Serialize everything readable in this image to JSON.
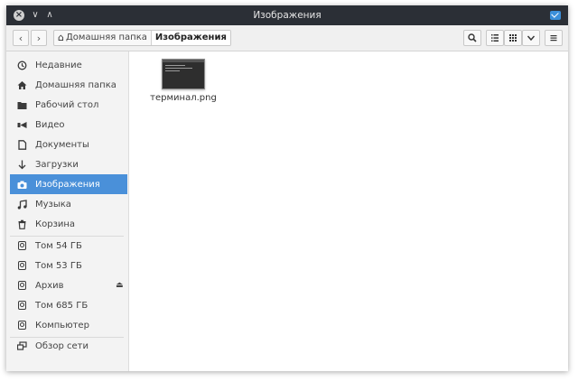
{
  "window": {
    "title": "Изображения"
  },
  "toolbar": {
    "breadcrumbs": [
      {
        "label": "Домашняя папка"
      },
      {
        "label": "Изображения"
      }
    ]
  },
  "sidebar": {
    "places": [
      {
        "label": "Недавние",
        "icon": "clock-icon"
      },
      {
        "label": "Домашняя папка",
        "icon": "home-icon"
      },
      {
        "label": "Рабочий стол",
        "icon": "folder-icon"
      },
      {
        "label": "Видео",
        "icon": "video-icon"
      },
      {
        "label": "Документы",
        "icon": "document-icon"
      },
      {
        "label": "Загрузки",
        "icon": "download-icon"
      },
      {
        "label": "Изображения",
        "icon": "camera-icon",
        "active": true
      },
      {
        "label": "Музыка",
        "icon": "music-icon"
      },
      {
        "label": "Корзина",
        "icon": "trash-icon"
      }
    ],
    "devices": [
      {
        "label": "Том 54 ГБ",
        "icon": "disk-icon"
      },
      {
        "label": "Том 53 ГБ",
        "icon": "disk-icon"
      },
      {
        "label": "Архив",
        "icon": "disk-icon",
        "ejectable": true
      },
      {
        "label": "Том 685 ГБ",
        "icon": "disk-icon"
      },
      {
        "label": "Компьютер",
        "icon": "computer-icon"
      }
    ],
    "network": [
      {
        "label": "Обзор сети",
        "icon": "network-icon"
      }
    ]
  },
  "files": [
    {
      "name": "терминал.png",
      "icon": "image-thumbnail-icon"
    }
  ],
  "colors": {
    "titlebar": "#2b2f36",
    "accent": "#4a90d9",
    "sidebar": "#f3f3f3"
  }
}
